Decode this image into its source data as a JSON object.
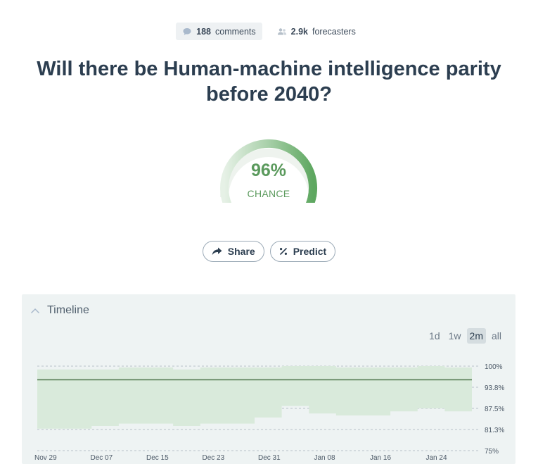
{
  "stats": {
    "comments_count": "188",
    "comments_label": "comments",
    "forecasters_count": "2.9k",
    "forecasters_label": "forecasters"
  },
  "question": {
    "title": "Will there be Human-machine intelligence parity before 2040?"
  },
  "gauge": {
    "value": "96%",
    "label": "CHANCE",
    "probability": 0.96
  },
  "actions": {
    "share_label": "Share",
    "predict_label": "Predict"
  },
  "timeline": {
    "title": "Timeline",
    "ranges": [
      "1d",
      "1w",
      "2m",
      "all"
    ],
    "active_range": "2m"
  },
  "colors": {
    "accent_green": "#5b9a5d",
    "band_green": "#d9eadb",
    "line_green": "#6e8f6c",
    "panel_bg": "#eef3f3"
  },
  "icons": {
    "comments": "comment-bubble-icon",
    "forecasters": "users-icon",
    "share": "share-arrow-icon",
    "predict": "percent-icon",
    "collapse": "chevron-up-icon"
  },
  "chart_data": {
    "type": "area",
    "title": "",
    "xlabel": "",
    "ylabel": "",
    "x_ticks": [
      "Nov 29",
      "Dec 07",
      "Dec 15",
      "Dec 23",
      "Dec 31",
      "Jan 08",
      "Jan 16",
      "Jan 24"
    ],
    "y_ticks": [
      "100%",
      "93.8%",
      "87.5%",
      "81.3%",
      "75%"
    ],
    "ylim": [
      75,
      100
    ],
    "series": [
      {
        "values": [
          96,
          96,
          96,
          96,
          96,
          96,
          96,
          96,
          96,
          96,
          96,
          96,
          96,
          96,
          96,
          96
        ]
      }
    ],
    "band_upper": [
      99,
      99,
      99,
      99.6,
      99.6,
      99,
      99.6,
      99.6,
      99.6,
      100,
      100,
      99.6,
      99.6,
      99.6,
      100,
      99.6
    ],
    "band_lower": [
      81.5,
      81.5,
      82.3,
      83,
      83,
      82.3,
      83,
      83,
      84.8,
      88.2,
      86,
      85.4,
      85.4,
      86.6,
      87.5,
      86.6
    ],
    "grid": true,
    "legend": "none"
  }
}
